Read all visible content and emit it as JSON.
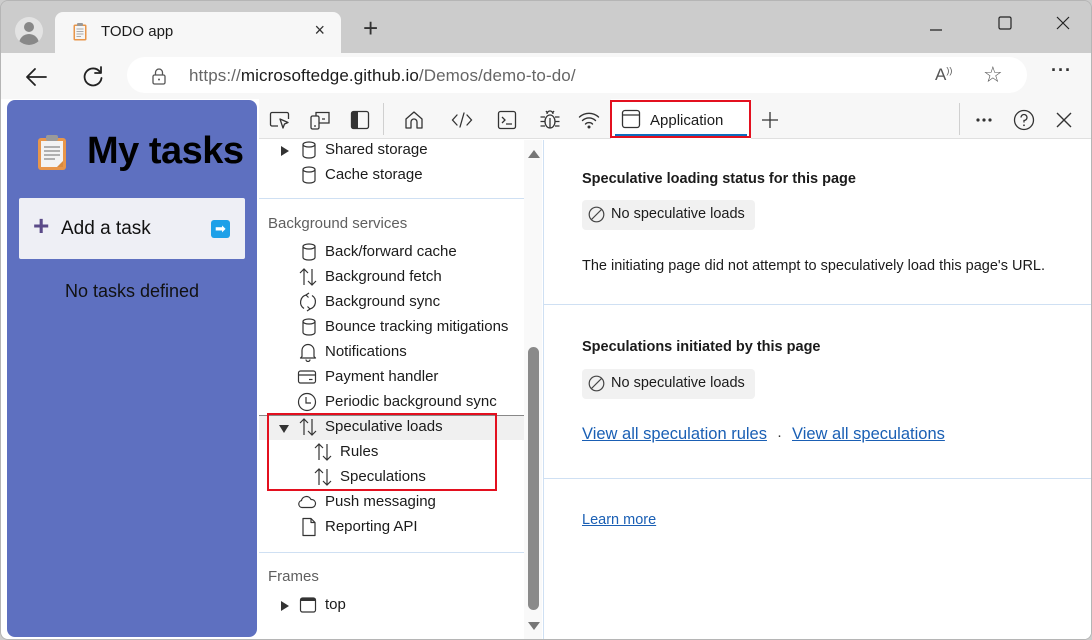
{
  "browser": {
    "tab": {
      "title": "TODO app",
      "close_label": "×"
    },
    "new_tab_label": "+",
    "url": {
      "scheme": "https://",
      "host": "microsoftedge.github.io",
      "path": "/Demos/demo-to-do/"
    },
    "read_aloud_label": "A",
    "favorite_glyph": "☆",
    "more_glyph": "···"
  },
  "todo_app": {
    "title": "My tasks",
    "add_task_placeholder": "Add a task",
    "add_plus": "+",
    "submit_glyph": "➡",
    "empty_message": "No tasks defined",
    "background_color": "#5e70c0"
  },
  "devtools": {
    "active_tab": "Application",
    "tools": [
      "Inspect",
      "Device emulation",
      "Toggle sidebar",
      "Welcome",
      "Elements",
      "Console",
      "Sources",
      "Network",
      "Application"
    ],
    "more_tools_label": "+",
    "highlight_color": "#e3101f",
    "sidebar": {
      "storage_items": [
        {
          "label": "Shared storage",
          "icon": "database-icon",
          "expandable": true
        },
        {
          "label": "Cache storage",
          "icon": "database-icon",
          "expandable": false
        }
      ],
      "background_services_title": "Background services",
      "background_services": [
        {
          "label": "Back/forward cache",
          "icon": "database-icon"
        },
        {
          "label": "Background fetch",
          "icon": "up-down-arrows-icon"
        },
        {
          "label": "Background sync",
          "icon": "sync-icon"
        },
        {
          "label": "Bounce tracking mitigations",
          "icon": "database-icon"
        },
        {
          "label": "Notifications",
          "icon": "bell-icon"
        },
        {
          "label": "Payment handler",
          "icon": "credit-card-icon"
        },
        {
          "label": "Periodic background sync",
          "icon": "clock-icon"
        },
        {
          "label": "Speculative loads",
          "icon": "up-down-arrows-icon",
          "expanded": true,
          "selected": true
        },
        {
          "label": "Rules",
          "icon": "up-down-arrows-icon",
          "child": true
        },
        {
          "label": "Speculations",
          "icon": "up-down-arrows-icon",
          "child": true
        },
        {
          "label": "Push messaging",
          "icon": "cloud-icon"
        },
        {
          "label": "Reporting API",
          "icon": "document-icon"
        }
      ],
      "frames_title": "Frames",
      "frames": [
        {
          "label": "top",
          "icon": "frame-icon",
          "expandable": true
        }
      ]
    },
    "main": {
      "status_section": {
        "title": "Speculative loading status for this page",
        "badge": "No speculative loads",
        "description": "The initiating page did not attempt to speculatively load this page's URL."
      },
      "initiated_section": {
        "title": "Speculations initiated by this page",
        "badge": "No speculative loads",
        "link_rules": "View all speculation rules",
        "separator": "·",
        "link_speculations": "View all speculations"
      },
      "learn_more": "Learn more"
    }
  }
}
